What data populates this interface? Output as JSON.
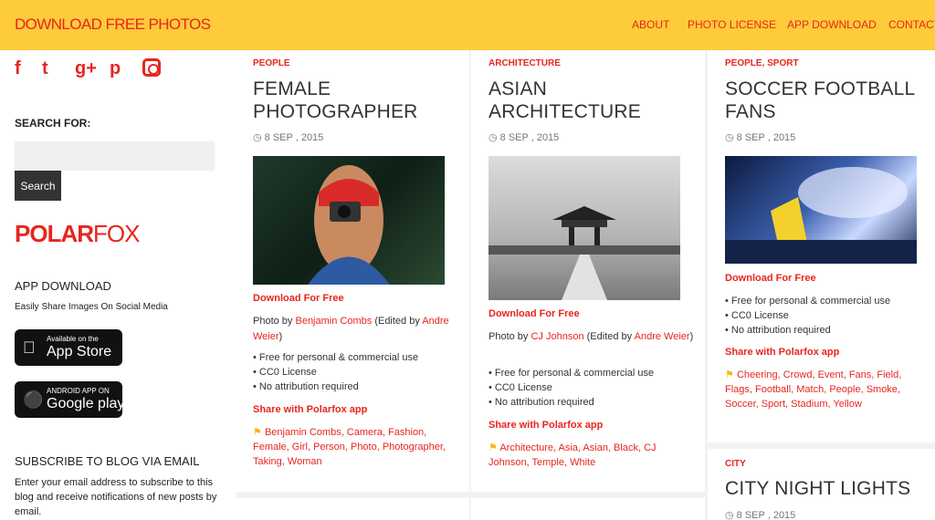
{
  "brand": "DOWNLOAD FREE PHOTOS",
  "nav": [
    "ABOUT",
    "PHOTO LICENSE",
    "APP DOWNLOAD",
    "CONTACT"
  ],
  "sidebar": {
    "social": [
      "f",
      "t",
      "g+",
      "p",
      "ig"
    ],
    "search_label": "SEARCH FOR:",
    "search_value": "",
    "search_button": "Search",
    "logo_a": "POLAR",
    "logo_b": "FOX",
    "app_title": "APP DOWNLOAD",
    "app_sub": "Easily Share Images On Social Media",
    "appstore_small": "Available on the",
    "appstore_big": "App Store",
    "google_small": "ANDROID APP ON",
    "google_big": "Google play",
    "subscribe_title": "SUBSCRIBE TO BLOG VIA EMAIL",
    "subscribe_text": "Enter your email address to subscribe to this blog and receive notifications of new posts by email."
  },
  "cards": [
    {
      "category": "PEOPLE",
      "title": "FEMALE PHOTOGRAPHER",
      "date": "8 SEP , 2015",
      "download": "Download For Free",
      "photo_by": "Photo by",
      "photographer": "Benjamin Combs",
      "edited_by": "(Edited by",
      "editor": "Andre Weier",
      "close": ")",
      "bullets": [
        "Free for personal & commercial use",
        "CC0 License",
        "No attribution required"
      ],
      "share": "Share with Polarfox app",
      "tags": "Benjamin Combs, Camera, Fashion, Female, Girl, Person, Photo, Photographer, Taking, Woman"
    },
    {
      "category": "ARCHITECTURE",
      "title": "ASIAN ARCHITECTURE",
      "date": "8 SEP , 2015",
      "download": "Download For Free",
      "photo_by": "Photo by",
      "photographer": "CJ Johnson",
      "edited_by": "(Edited by",
      "editor": "Andre Weier",
      "close": ")",
      "bullets": [
        "Free for personal & commercial use",
        "CC0 License",
        "No attribution required"
      ],
      "share": "Share with Polarfox app",
      "tags": "Architecture, Asia, Asian, Black, CJ Johnson, Temple, White"
    },
    {
      "category": "PEOPLE, SPORT",
      "title": "SOCCER FOOTBALL FANS",
      "date": "8 SEP , 2015",
      "download": "Download For Free",
      "bullets": [
        "Free for personal & commercial use",
        "CC0 License",
        "No attribution required"
      ],
      "share": "Share with Polarfox app",
      "tags": "Cheering, Crowd, Event, Fans, Field, Flags, Football, Match, People, Smoke, Soccer, Sport, Stadium, Yellow"
    },
    {
      "category": "CITY",
      "title": "CITY NIGHT LIGHTS",
      "date": "8 SEP , 2015"
    }
  ],
  "colors": {
    "accent": "#e8251e",
    "header": "#fecb3a"
  }
}
